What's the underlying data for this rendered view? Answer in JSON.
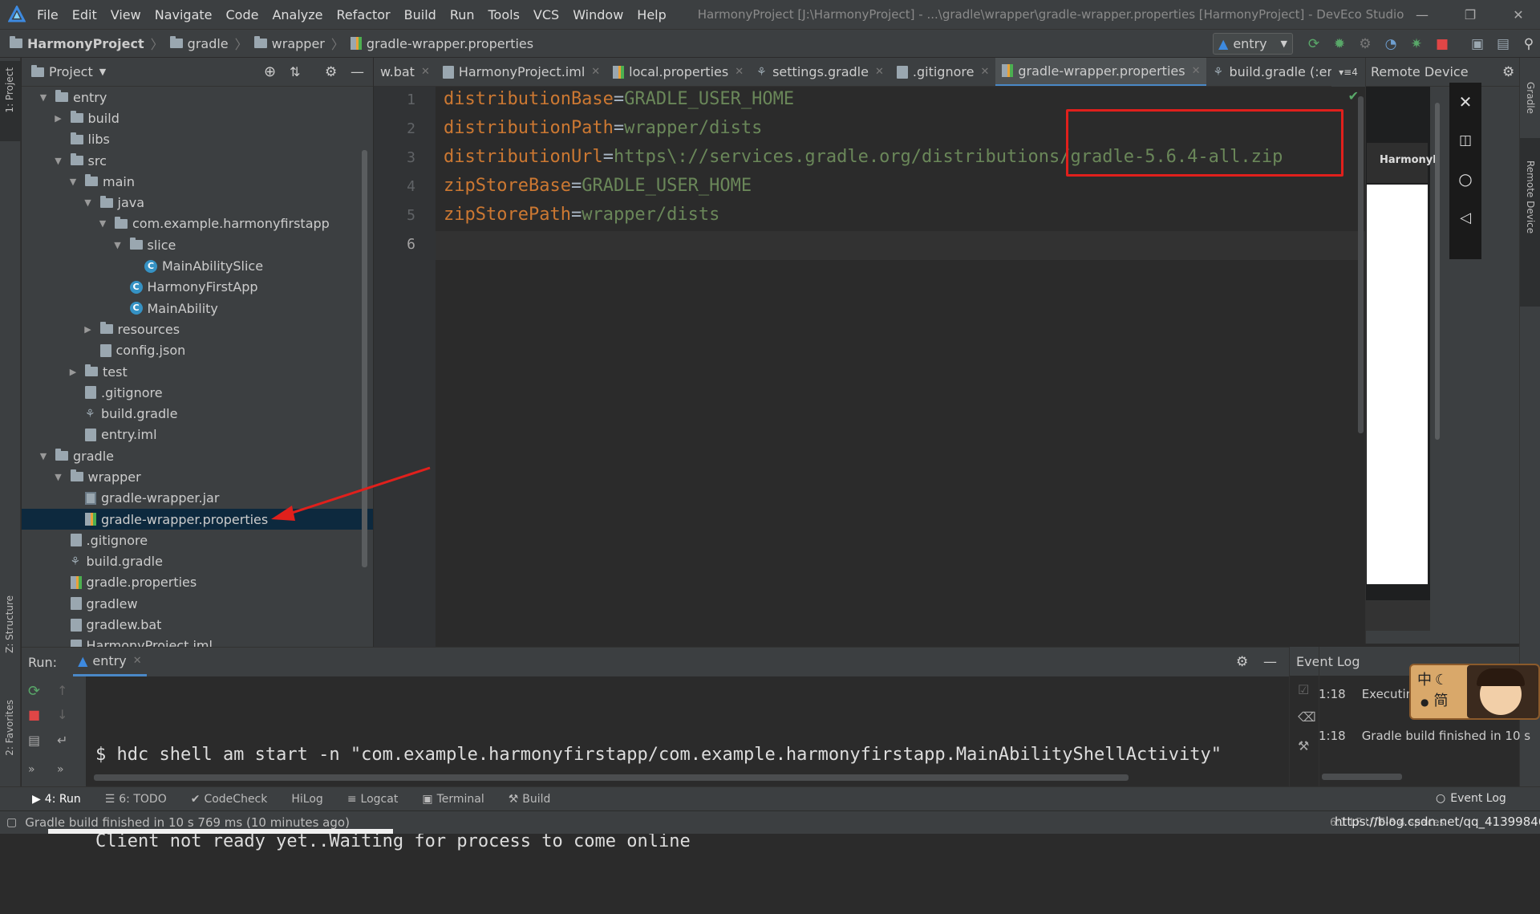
{
  "window": {
    "title": "HarmonyProject [J:\\HarmonyProject] - ...\\gradle\\wrapper\\gradle-wrapper.properties [HarmonyProject] - DevEco Studio",
    "menu": [
      "File",
      "Edit",
      "View",
      "Navigate",
      "Code",
      "Analyze",
      "Refactor",
      "Build",
      "Run",
      "Tools",
      "VCS",
      "Window",
      "Help"
    ]
  },
  "breadcrumb": [
    "HarmonyProject",
    "gradle",
    "wrapper",
    "gradle-wrapper.properties"
  ],
  "toolbar": {
    "run_config": "entry"
  },
  "project_panel": {
    "title": "Project",
    "tree": [
      {
        "label": "entry",
        "depth": 0,
        "kind": "folder",
        "expanded": true
      },
      {
        "label": "build",
        "depth": 1,
        "kind": "folder",
        "expanded": false
      },
      {
        "label": "libs",
        "depth": 1,
        "kind": "folder",
        "leaf": true
      },
      {
        "label": "src",
        "depth": 1,
        "kind": "folder",
        "expanded": true
      },
      {
        "label": "main",
        "depth": 2,
        "kind": "folder",
        "expanded": true
      },
      {
        "label": "java",
        "depth": 3,
        "kind": "folder",
        "expanded": true
      },
      {
        "label": "com.example.harmonyfirstapp",
        "depth": 4,
        "kind": "folder",
        "expanded": true
      },
      {
        "label": "slice",
        "depth": 5,
        "kind": "folder",
        "expanded": true
      },
      {
        "label": "MainAbilitySlice",
        "depth": 6,
        "kind": "class",
        "leaf": true
      },
      {
        "label": "HarmonyFirstApp",
        "depth": 5,
        "kind": "class",
        "leaf": true
      },
      {
        "label": "MainAbility",
        "depth": 5,
        "kind": "class",
        "leaf": true
      },
      {
        "label": "resources",
        "depth": 3,
        "kind": "folder",
        "expanded": false
      },
      {
        "label": "config.json",
        "depth": 3,
        "kind": "file",
        "leaf": true
      },
      {
        "label": "test",
        "depth": 2,
        "kind": "folder",
        "expanded": false
      },
      {
        "label": ".gitignore",
        "depth": 2,
        "kind": "file",
        "leaf": true
      },
      {
        "label": "build.gradle",
        "depth": 2,
        "kind": "gradle",
        "leaf": true
      },
      {
        "label": "entry.iml",
        "depth": 2,
        "kind": "file",
        "leaf": true
      },
      {
        "label": "gradle",
        "depth": 0,
        "kind": "folder",
        "expanded": true
      },
      {
        "label": "wrapper",
        "depth": 1,
        "kind": "folder",
        "expanded": true
      },
      {
        "label": "gradle-wrapper.jar",
        "depth": 2,
        "kind": "jar",
        "leaf": true
      },
      {
        "label": "gradle-wrapper.properties",
        "depth": 2,
        "kind": "props",
        "leaf": true,
        "selected": true
      },
      {
        "label": ".gitignore",
        "depth": 1,
        "kind": "file",
        "leaf": true
      },
      {
        "label": "build.gradle",
        "depth": 1,
        "kind": "gradle",
        "leaf": true
      },
      {
        "label": "gradle.properties",
        "depth": 1,
        "kind": "props",
        "leaf": true
      },
      {
        "label": "gradlew",
        "depth": 1,
        "kind": "file",
        "leaf": true
      },
      {
        "label": "gradlew.bat",
        "depth": 1,
        "kind": "file",
        "leaf": true
      },
      {
        "label": "HarmonyProject.iml",
        "depth": 1,
        "kind": "file",
        "leaf": true
      }
    ]
  },
  "editor_tabs": [
    {
      "label": "w.bat"
    },
    {
      "label": "HarmonyProject.iml"
    },
    {
      "label": "local.properties"
    },
    {
      "label": "settings.gradle"
    },
    {
      "label": ".gitignore"
    },
    {
      "label": "gradle-wrapper.properties",
      "active": true
    },
    {
      "label": "build.gradle (:entry"
    }
  ],
  "tabs_overflow": "4",
  "editor": {
    "lines": [
      {
        "key": "distributionBase",
        "value": "GRADLE_USER_HOME"
      },
      {
        "key": "distributionPath",
        "value": "wrapper/dists"
      },
      {
        "key": "distributionUrl",
        "value": "https\\://services.gradle.org/distributions/gradle-5.6.4-all.zip"
      },
      {
        "key": "zipStoreBase",
        "value": "GRADLE_USER_HOME"
      },
      {
        "key": "zipStorePath",
        "value": "wrapper/dists"
      },
      {
        "key": "",
        "value": ""
      }
    ],
    "line_numbers": [
      "1",
      "2",
      "3",
      "4",
      "5",
      "6"
    ]
  },
  "remote_device": {
    "title": "Remote Device",
    "app_label": "Harmonyl"
  },
  "run_panel": {
    "label": "Run:",
    "tab": "entry",
    "console": [
      "$ hdc shell am start -n \"com.example.harmonyfirstapp/com.example.harmonyfirstapp.MainAbilityShellActivity\"",
      "Client not ready yet..Waiting for process to come online"
    ]
  },
  "event_log": {
    "title": "Event Log",
    "entries": [
      {
        "time": "1:18",
        "text": "Executin"
      },
      {
        "time": "1:18",
        "text": "Gradle build finished in 10 s"
      }
    ],
    "ime": [
      "中",
      "简"
    ]
  },
  "bottom_tabs": [
    "4: Run",
    "6: TODO",
    "CodeCheck",
    "HiLog",
    "Logcat",
    "Terminal",
    "Build"
  ],
  "bottom_right_tab": "Event Log",
  "status": {
    "message": "Gradle build finished in 10 s 769 ms (10 minutes ago)",
    "right": "6:1  LF  UTF-8  4 spaces",
    "watermark": "https://blog.csdn.net/qq_41399846"
  },
  "left_strip": [
    "1: Project",
    "Z: Structure",
    "2: Favorites"
  ],
  "right_strip": [
    "Gradle",
    "Remote Device"
  ],
  "colors": {
    "accent": "#4a88c7",
    "annotation": "#e0201c",
    "key": "#cc7832",
    "value": "#6a8759"
  }
}
